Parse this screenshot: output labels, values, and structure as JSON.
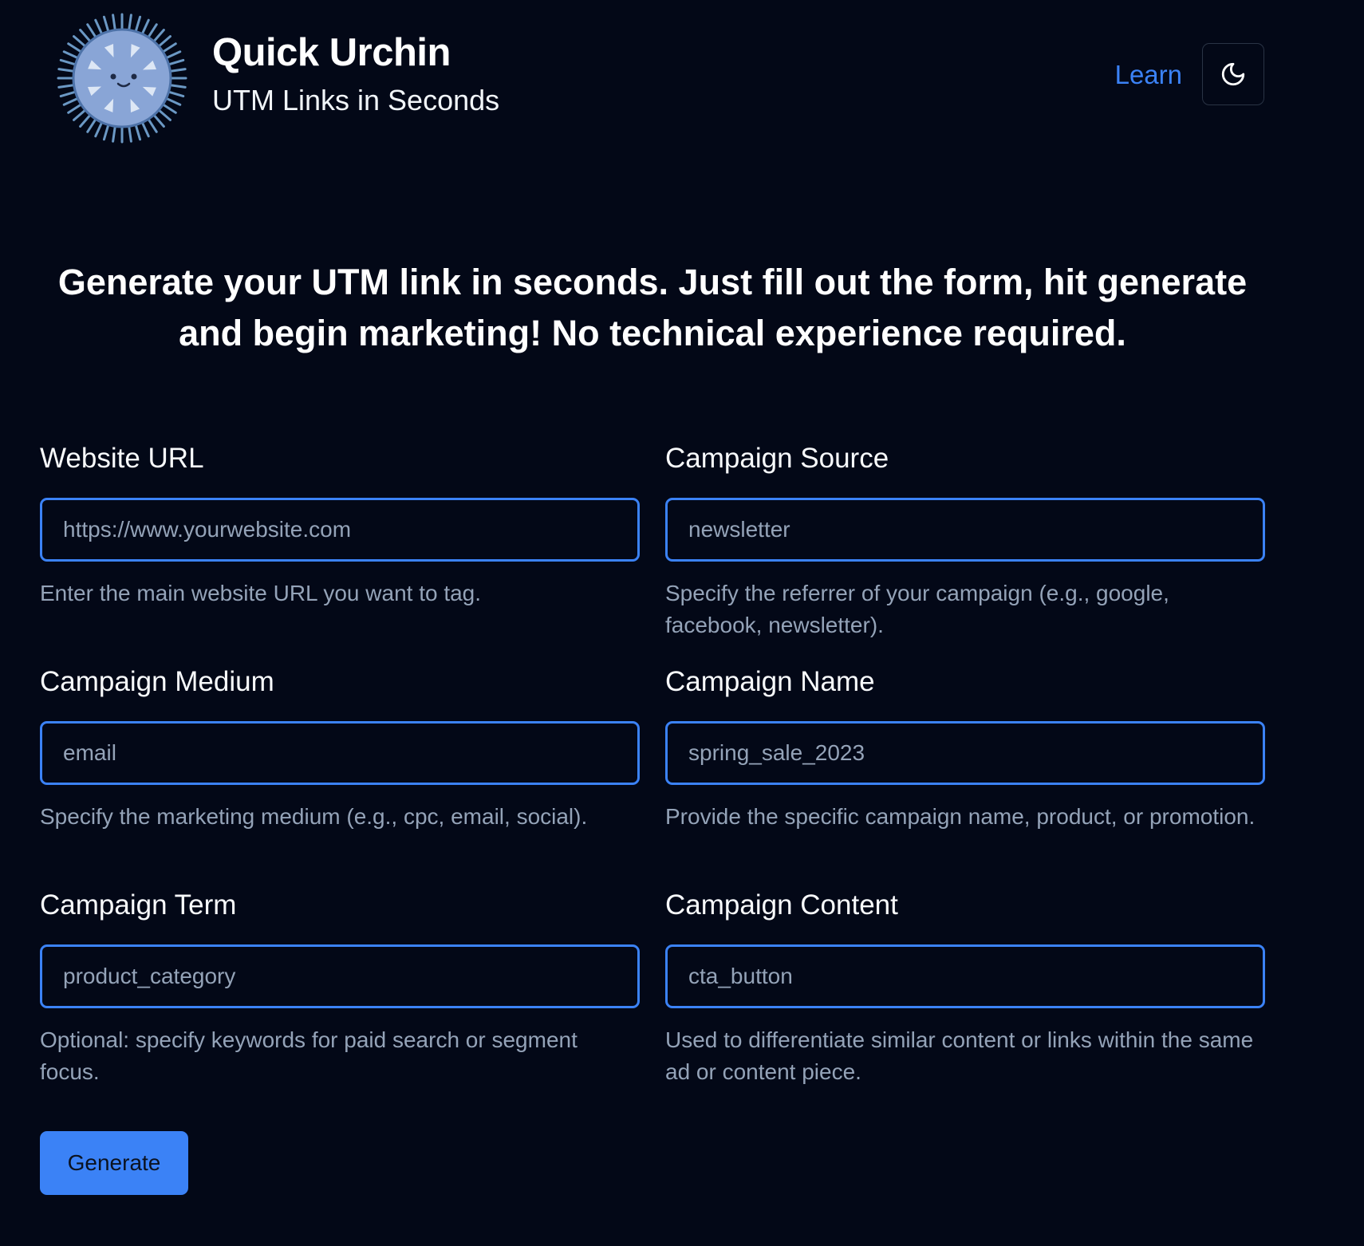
{
  "header": {
    "brand_name": "Quick Urchin",
    "tagline": "UTM Links in Seconds",
    "learn_label": "Learn",
    "theme_toggle_icon": "moon-icon",
    "logo_icon": "urchin-logo"
  },
  "hero": {
    "text": "Generate your UTM link in seconds. Just fill out the form, hit generate and begin marketing! No technical experience required."
  },
  "form": {
    "fields": [
      {
        "label": "Website URL",
        "placeholder": "https://www.yourwebsite.com",
        "value": "",
        "help": "Enter the main website URL you want to tag."
      },
      {
        "label": "Campaign Source",
        "placeholder": "newsletter",
        "value": "",
        "help": "Specify the referrer of your campaign (e.g., google, facebook, newsletter)."
      },
      {
        "label": "Campaign Medium",
        "placeholder": "email",
        "value": "",
        "help": "Specify the marketing medium (e.g., cpc, email, social)."
      },
      {
        "label": "Campaign Name",
        "placeholder": "spring_sale_2023",
        "value": "",
        "help": "Provide the specific campaign name, product, or promotion."
      },
      {
        "label": "Campaign Term",
        "placeholder": "product_category",
        "value": "",
        "help": "Optional: specify keywords for paid search or segment focus."
      },
      {
        "label": "Campaign Content",
        "placeholder": "cta_button",
        "value": "",
        "help": "Used to differentiate similar content or links within the same ad or content piece."
      }
    ],
    "submit_label": "Generate"
  },
  "colors": {
    "background": "#030817",
    "accent": "#3b82f6",
    "muted_text": "#94a3b8",
    "text": "#f8fafc"
  }
}
